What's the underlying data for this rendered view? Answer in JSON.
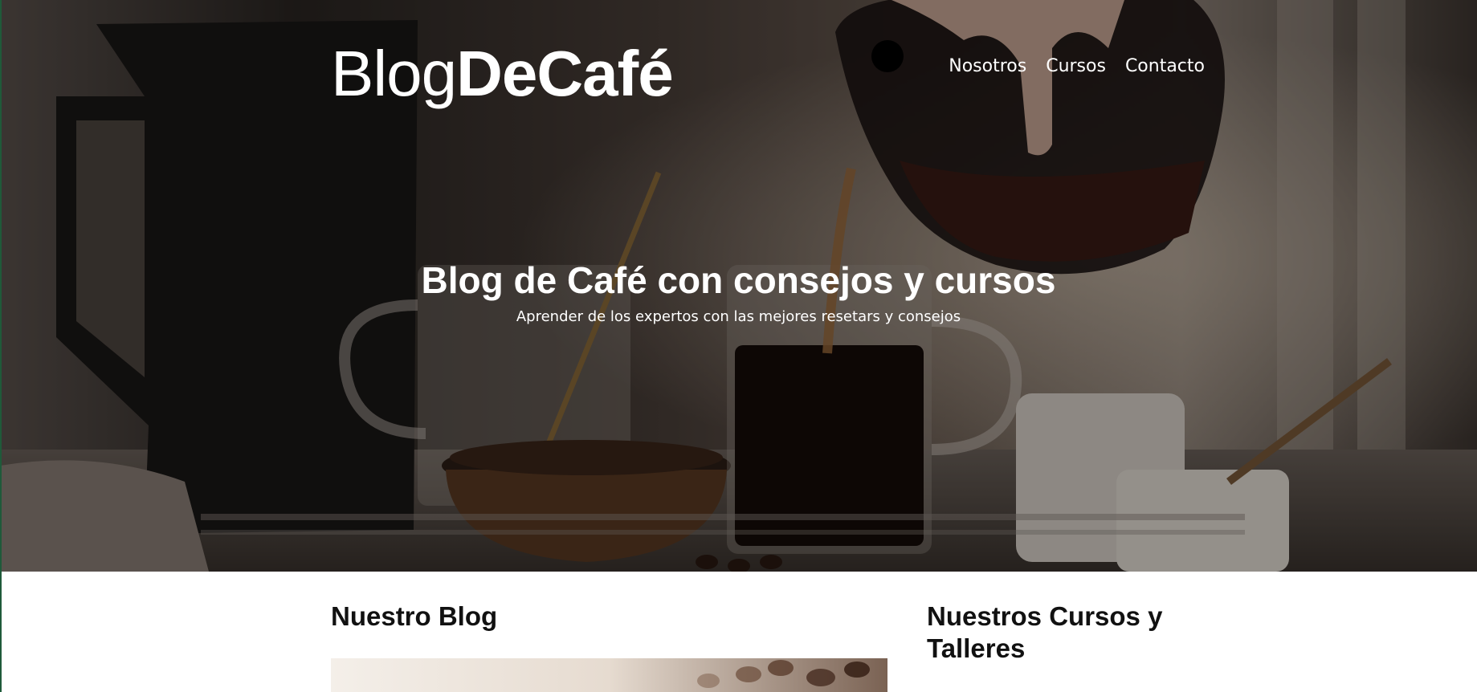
{
  "header": {
    "logo_light": "Blog",
    "logo_bold": "DeCafé",
    "nav": [
      {
        "label": "Nosotros"
      },
      {
        "label": "Cursos"
      },
      {
        "label": "Contacto"
      }
    ]
  },
  "hero": {
    "title": "Blog de Café con consejos y cursos",
    "subtitle": "Aprender de los expertos con las mejores resetars y consejos"
  },
  "main": {
    "blog": {
      "title": "Nuestro Blog"
    },
    "courses": {
      "title": "Nuestros Cursos y Talleres"
    }
  }
}
